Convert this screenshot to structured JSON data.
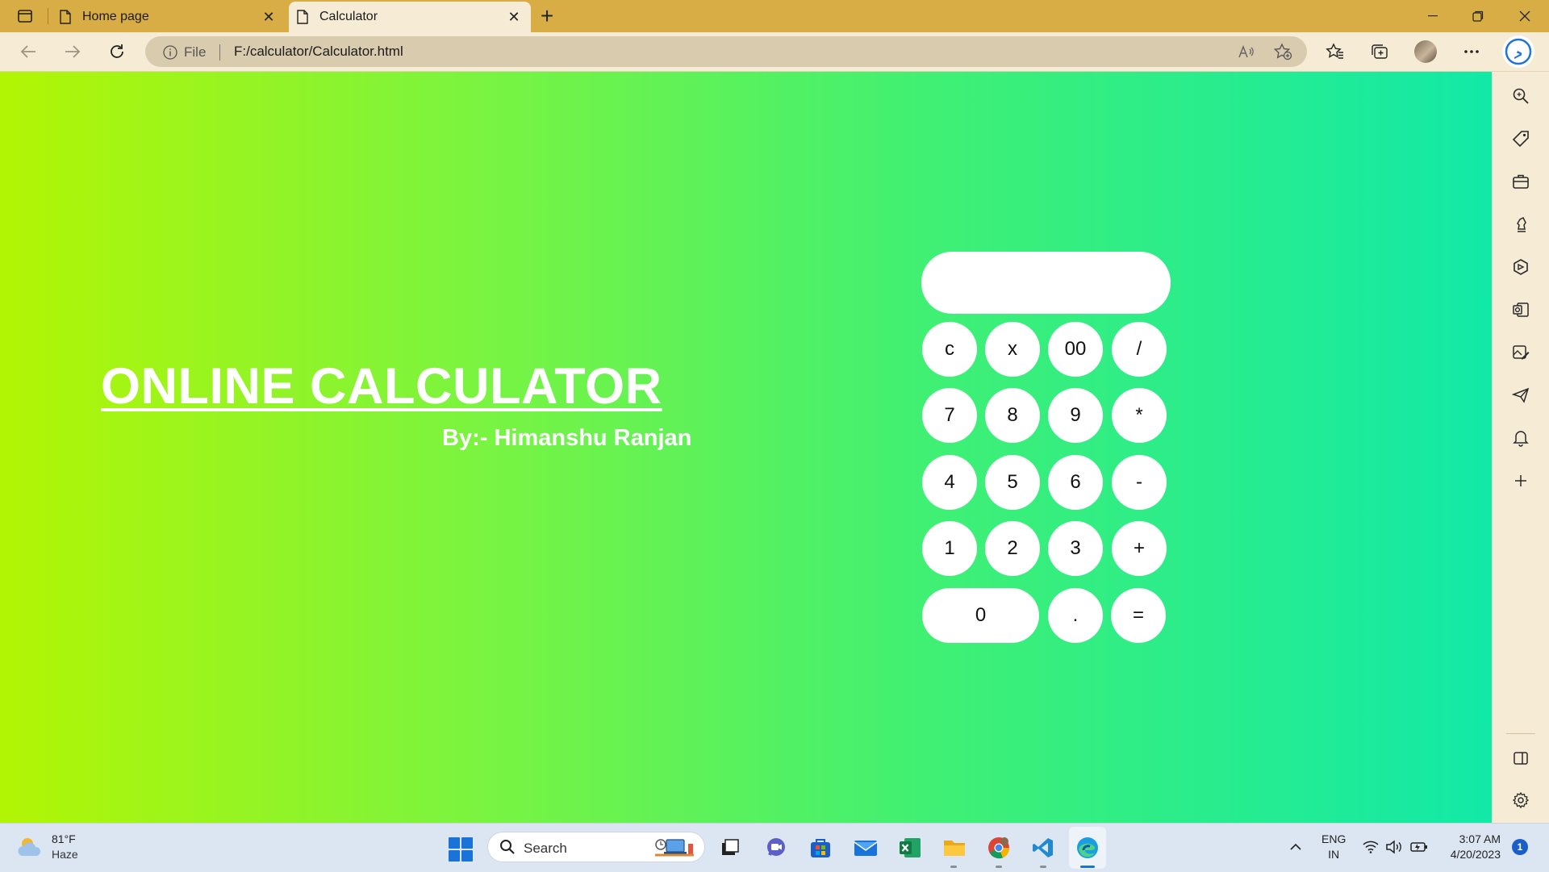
{
  "browser": {
    "tabs": [
      {
        "label": "Home page",
        "active": false
      },
      {
        "label": "Calculator",
        "active": true
      }
    ],
    "address": {
      "scheme_label": "File",
      "url": "F:/calculator/Calculator.html"
    }
  },
  "page": {
    "headline": "ONLINE CALCULATOR",
    "author": "By:- Himanshu Ranjan",
    "display_value": "",
    "buttons": [
      [
        "c",
        "x",
        "00",
        "/"
      ],
      [
        "7",
        "8",
        "9",
        "*"
      ],
      [
        "4",
        "5",
        "6",
        "-"
      ],
      [
        "1",
        "2",
        "3",
        "+"
      ],
      [
        "0",
        ".",
        "="
      ]
    ]
  },
  "taskbar": {
    "weather_temp": "81°F",
    "weather_desc": "Haze",
    "search_label": "Search",
    "lang_primary": "ENG",
    "lang_secondary": "IN",
    "time": "3:07 AM",
    "date": "4/20/2023",
    "notification_count": "1"
  },
  "colors": {
    "background_gradient": [
      "#b2f504",
      "#7af440",
      "#40f073",
      "#12e9a7"
    ],
    "tab_strip": "#d9ad45",
    "toolbar": "#f6ecd6"
  }
}
